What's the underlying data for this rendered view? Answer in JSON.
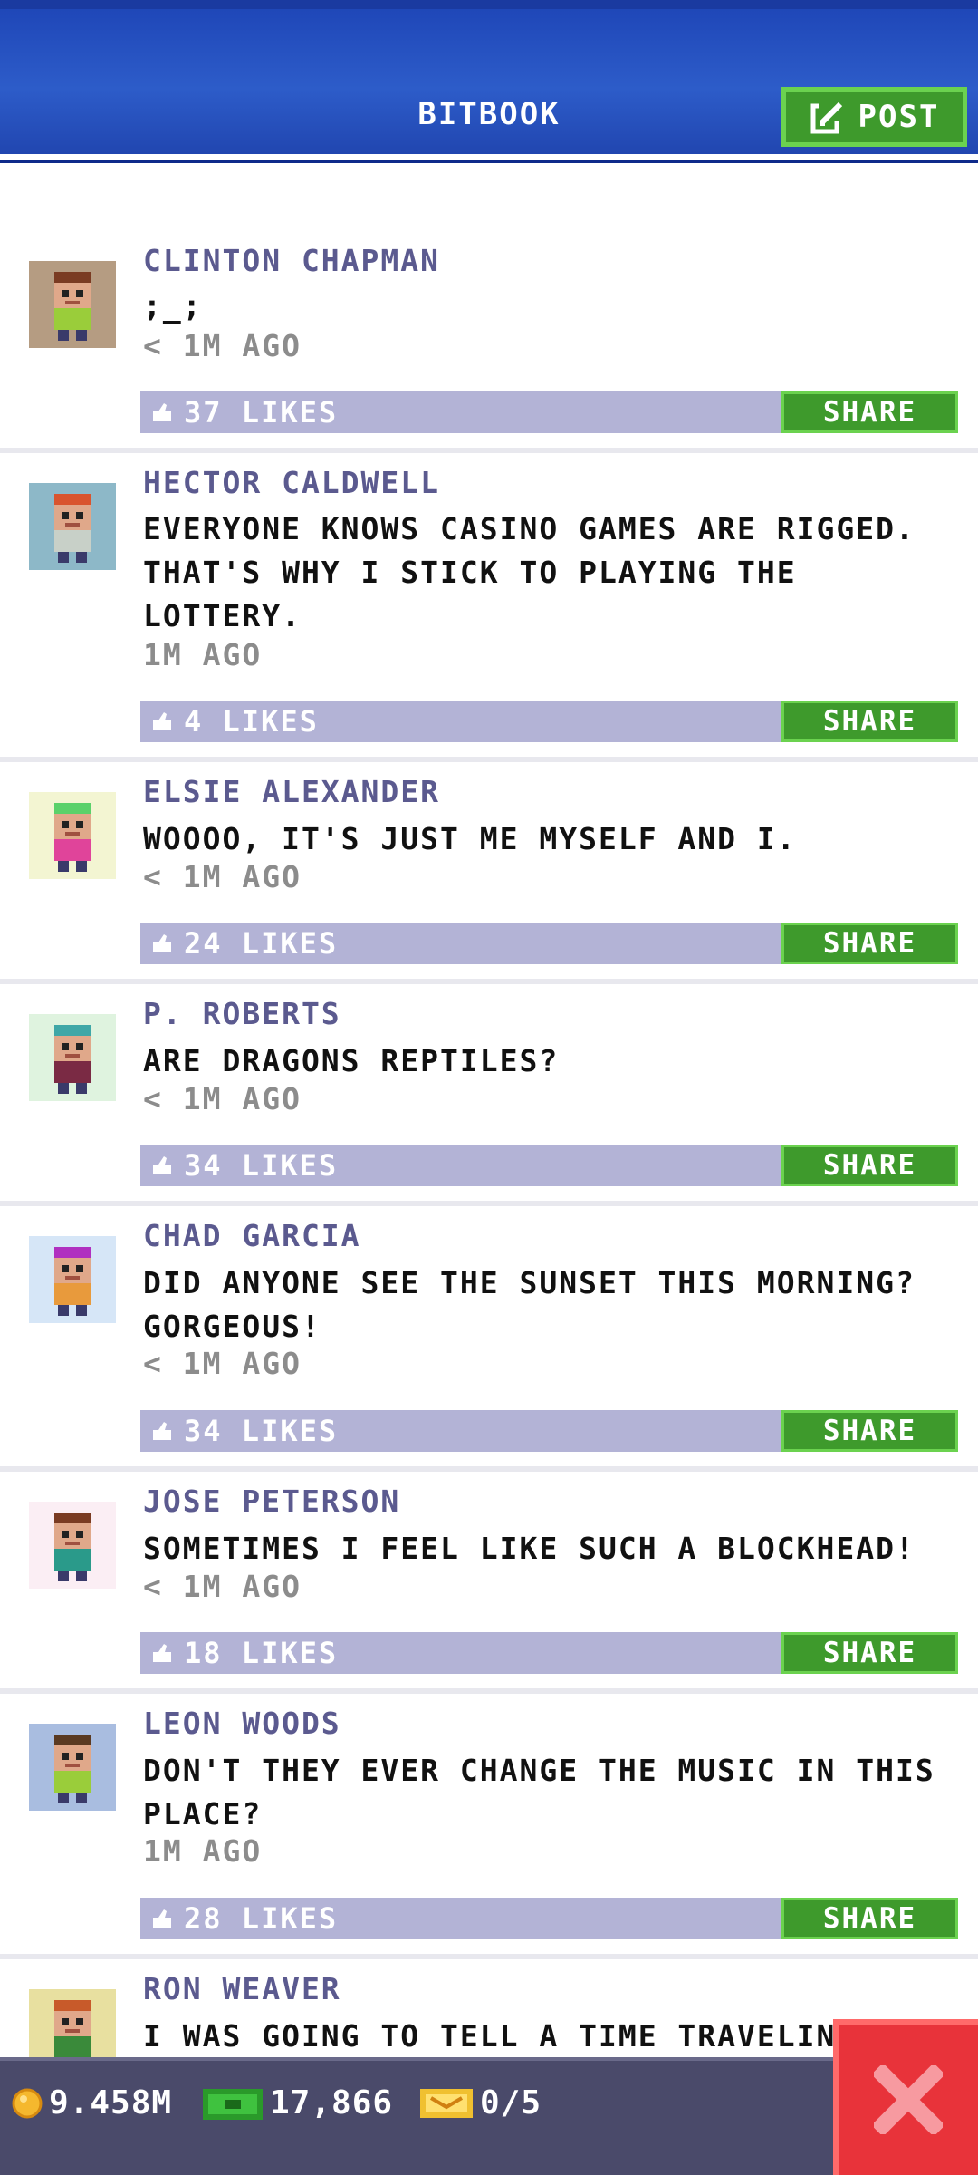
{
  "header": {
    "title": "BITBOOK",
    "post_label": "POST"
  },
  "posts": [
    {
      "name": "CLINTON CHAPMAN",
      "message": ";_;",
      "time": "< 1M AGO",
      "likes": "37 LIKES",
      "share": "SHARE",
      "avatar_bg": "#b59c82",
      "hair": "#7a3b22",
      "shirt": "#9acd3a"
    },
    {
      "name": "HECTOR CALDWELL",
      "message": "EVERYONE KNOWS CASINO GAMES ARE RIGGED. THAT'S WHY I STICK TO PLAYING THE LOTTERY.",
      "time": "1M AGO",
      "likes": "4 LIKES",
      "share": "SHARE",
      "avatar_bg": "#8db8c8",
      "hair": "#d9542e",
      "shirt": "#c8d0c8"
    },
    {
      "name": "ELSIE ALEXANDER",
      "message": "WOOOO, IT'S JUST ME MYSELF AND I.",
      "time": "< 1M AGO",
      "likes": "24 LIKES",
      "share": "SHARE",
      "avatar_bg": "#f3f5d2",
      "hair": "#5ad16a",
      "shirt": "#e0449a"
    },
    {
      "name": "P. ROBERTS",
      "message": "ARE DRAGONS REPTILES?",
      "time": "< 1M AGO",
      "likes": "34 LIKES",
      "share": "SHARE",
      "avatar_bg": "#dff3df",
      "hair": "#3fa7a7",
      "shirt": "#7a2a44"
    },
    {
      "name": "CHAD GARCIA",
      "message": "DID ANYONE SEE THE SUNSET THIS MORNING? GORGEOUS!",
      "time": "< 1M AGO",
      "likes": "34 LIKES",
      "share": "SHARE",
      "avatar_bg": "#d6e6f7",
      "hair": "#b030c0",
      "shirt": "#e89a3c"
    },
    {
      "name": "JOSE PETERSON",
      "message": "SOMETIMES I FEEL LIKE SUCH A BLOCKHEAD!",
      "time": "< 1M AGO",
      "likes": "18 LIKES",
      "share": "SHARE",
      "avatar_bg": "#fbeef4",
      "hair": "#7a3b22",
      "shirt": "#2a9a8a"
    },
    {
      "name": "LEON WOODS",
      "message": "DON'T THEY EVER CHANGE THE MUSIC IN THIS PLACE?",
      "time": "1M AGO",
      "likes": "28 LIKES",
      "share": "SHARE",
      "avatar_bg": "#a9bde0",
      "hair": "#5a3a22",
      "shirt": "#9acd3a"
    },
    {
      "name": "RON WEAVER",
      "message": "I WAS GOING TO TELL A TIME TRAVELING",
      "time": "",
      "likes": "",
      "share": "",
      "avatar_bg": "#e8e0a0",
      "hair": "#c85a2a",
      "shirt": "#3a8a3a"
    }
  ],
  "status": {
    "coins": "9.458M",
    "bux": "17,866",
    "tickets": "0/5"
  },
  "colors": {
    "header": "#2d5cc9",
    "share_green": "#3e9a2c",
    "likes_bar": "#b3b3d6",
    "close_red": "#e8333a"
  }
}
